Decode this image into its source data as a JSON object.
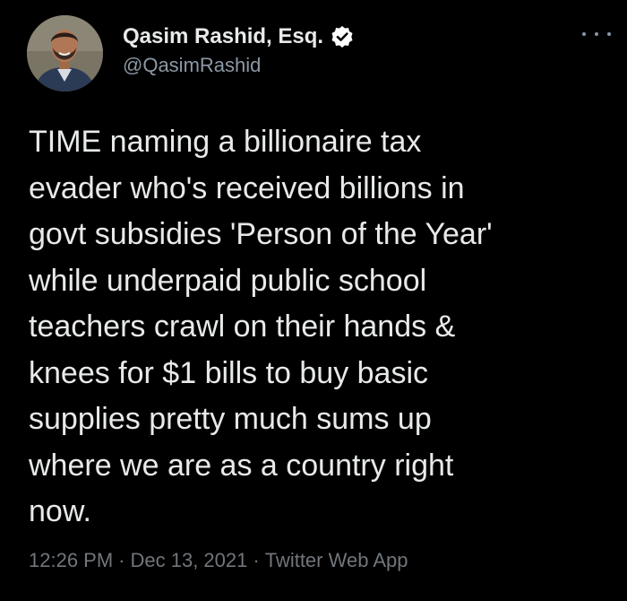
{
  "author": {
    "display_name": "Qasim Rashid, Esq.",
    "handle": "@QasimRashid",
    "verified": true,
    "verified_color": "#ffffff"
  },
  "menu": {
    "icon": "more-horizontal-icon"
  },
  "tweet": {
    "lines": [
      "TIME naming a billionaire tax",
      "evader who's received billions in",
      "govt subsidies 'Person of the Year'",
      "while underpaid public school",
      "teachers crawl on their hands &",
      "knees for $1 bills to buy basic",
      "supplies pretty much sums up",
      "where we are as a country right",
      "now."
    ],
    "time": "12:26 PM",
    "date": "Dec 13, 2021",
    "source": "Twitter Web App",
    "separator": "·"
  },
  "colors": {
    "background": "#000000",
    "text": "#e7e9ea",
    "secondary": "#71767b"
  }
}
